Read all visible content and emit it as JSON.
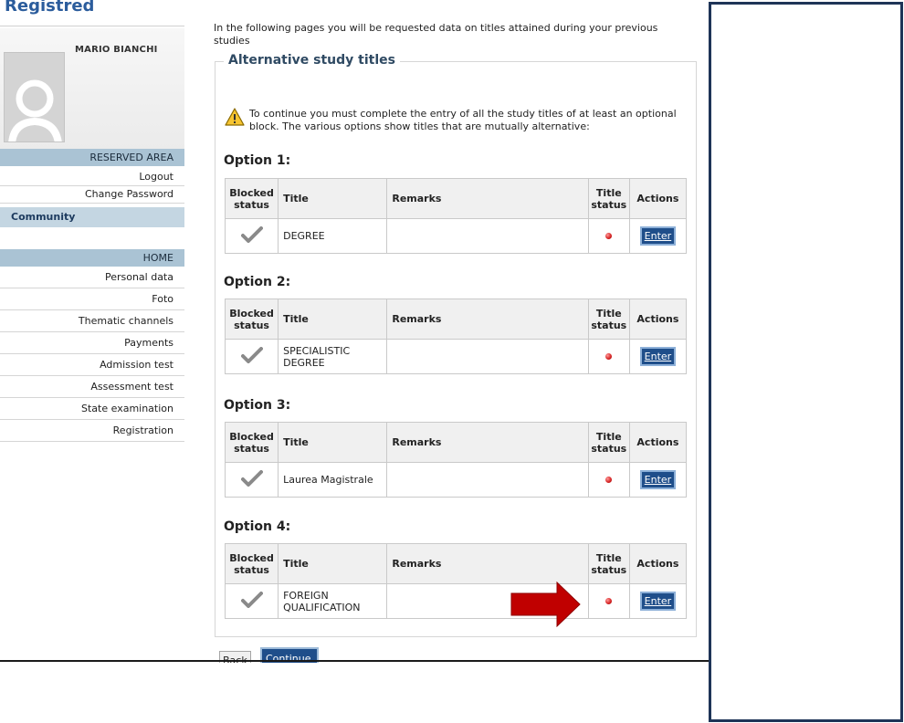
{
  "header": {
    "site_title": "Registred"
  },
  "profile": {
    "name": "MARIO BIANCHI"
  },
  "sidebar": {
    "reserved_area": {
      "heading": "RESERVED AREA",
      "items": [
        "Logout",
        "Change Password"
      ]
    },
    "community": "Community",
    "home": {
      "heading": "HOME",
      "items": [
        "Personal data",
        "Foto",
        "Thematic channels",
        "Payments",
        "Admission test",
        "Assessment test",
        "State examination",
        "Registration"
      ]
    }
  },
  "main": {
    "intro": "In the following pages you will be requested data on titles attained during your previous studies",
    "section_title": "Alternative study titles",
    "warning": "To continue you must complete the entry of all the study titles of at least an optional block. The various options show titles that are mutually alternative:",
    "table_headers": {
      "blocked": "Blocked status",
      "title": "Title",
      "remarks": "Remarks",
      "status": "Title status",
      "actions": "Actions"
    },
    "options": [
      {
        "label": "Option 1:",
        "title": "DEGREE",
        "remarks": "",
        "action": "Enter"
      },
      {
        "label": "Option 2:",
        "title": "SPECIALISTIC DEGREE",
        "remarks": "",
        "action": "Enter"
      },
      {
        "label": "Option 3:",
        "title": "Laurea Magistrale",
        "remarks": "",
        "action": "Enter"
      },
      {
        "label": "Option 4:",
        "title": "FOREIGN QUALIFICATION",
        "remarks": "",
        "action": "Enter"
      }
    ],
    "buttons": {
      "back": "Back",
      "continue": "Continue"
    }
  },
  "colors": {
    "brand_blue": "#2b5c9c",
    "button_blue": "#1f4e8a",
    "menu_header": "#aac3d4",
    "arrow_red": "#c00000",
    "status_dot": "#d42020",
    "panel_border": "#1e3457"
  },
  "icons": {
    "warning": "warning-triangle-icon",
    "blocked": "checkmark-icon",
    "status": "red-dot-icon",
    "annotation": "red-arrow-icon"
  }
}
